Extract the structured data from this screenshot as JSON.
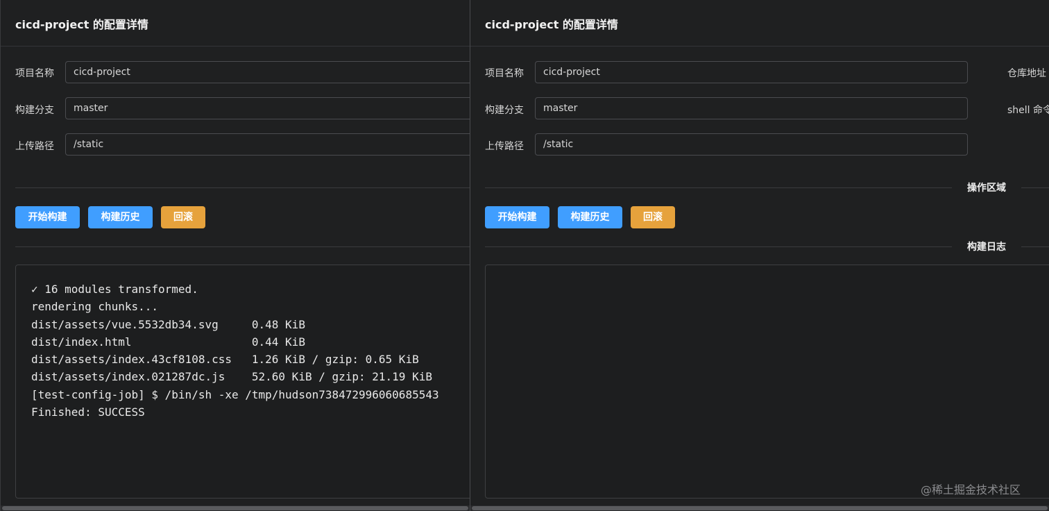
{
  "left_panel": {
    "title": "cicd-project 的配置详情",
    "form": {
      "project_name_label": "项目名称",
      "project_name_value": "cicd-project",
      "branch_label": "构建分支",
      "branch_value": "master",
      "upload_path_label": "上传路径",
      "upload_path_value": "/static"
    },
    "buttons": {
      "start_build": "开始构建",
      "build_history": "构建历史",
      "rollback": "回滚"
    },
    "log_lines": [
      "✓ 16 modules transformed.",
      "rendering chunks...",
      "dist/assets/vue.5532db34.svg     0.48 KiB",
      "dist/index.html                  0.44 KiB",
      "dist/assets/index.43cf8108.css   1.26 KiB / gzip: 0.65 KiB",
      "dist/assets/index.021287dc.js    52.60 KiB / gzip: 21.19 KiB",
      "[test-config-job] $ /bin/sh -xe /tmp/hudson738472996060685543",
      "Finished: SUCCESS"
    ]
  },
  "right_panel": {
    "title": "cicd-project 的配置详情",
    "form": {
      "project_name_label": "项目名称",
      "project_name_value": "cicd-project",
      "branch_label": "构建分支",
      "branch_value": "master",
      "upload_path_label": "上传路径",
      "upload_path_value": "/static",
      "repo_url_label": "仓库地址",
      "shell_cmd_label": "shell 命令"
    },
    "dividers": {
      "operation_area": "操作区域",
      "build_log": "构建日志"
    },
    "buttons": {
      "start_build": "开始构建",
      "build_history": "构建历史",
      "rollback": "回滚"
    }
  },
  "watermark": "@稀土掘金技术社区",
  "colors": {
    "primary": "#409eff",
    "warning": "#e6a23c",
    "background": "#1f2021"
  }
}
